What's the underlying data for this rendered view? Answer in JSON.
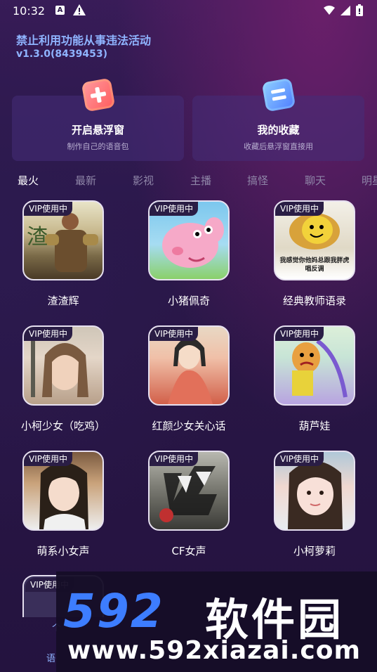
{
  "status_bar": {
    "time": "10:32",
    "a_label": "A"
  },
  "app": {
    "title": "禁止利用功能从事违法活动",
    "version": "v1.3.0(8439453)"
  },
  "cards": [
    {
      "title": "开启悬浮窗",
      "subtitle": "制作自己的语音包",
      "icon": "plus-icon"
    },
    {
      "title": "我的收藏",
      "subtitle": "收藏后悬浮窗直接用",
      "icon": "list-icon"
    }
  ],
  "tabs": [
    "最火",
    "最新",
    "影视",
    "主播",
    "搞怪",
    "聊天",
    "明星"
  ],
  "active_tab": "最火",
  "vip_badge": "VIP使用中",
  "items": [
    {
      "label": "渣渣辉"
    },
    {
      "label": "小猪佩奇"
    },
    {
      "label": "经典教师语录",
      "caption": "我感觉你他妈总跟我胖虎唱反调"
    },
    {
      "label": "小柯少女（吃鸡）"
    },
    {
      "label": "红颜少女关心话"
    },
    {
      "label": "葫芦娃"
    },
    {
      "label": "萌系小女声"
    },
    {
      "label": "CF女声"
    },
    {
      "label": "小柯萝莉"
    }
  ],
  "watermark": {
    "logo_num": "592",
    "logo_cn": "软件园",
    "url": "www.592xiazai.com"
  },
  "corner_text": "语",
  "corner_mark": "个"
}
